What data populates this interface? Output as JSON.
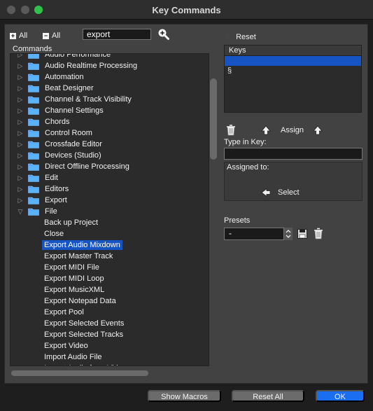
{
  "window": {
    "title": "Key Commands"
  },
  "toolbar": {
    "expand_all_label": "All",
    "collapse_all_label": "All",
    "search_value": "export",
    "commands_label": "Commands"
  },
  "tree": {
    "folders": [
      "Audio Performance",
      "Audio Realtime Processing",
      "Automation",
      "Beat Designer",
      "Channel & Track Visibility",
      "Channel Settings",
      "Chords",
      "Control Room",
      "Crossfade Editor",
      "Devices (Studio)",
      "Direct Offline Processing",
      "Edit",
      "Editors",
      "Export"
    ],
    "open_folder": "File",
    "file_items": [
      "Back up Project",
      "Close",
      "Export Audio Mixdown",
      "Export Master Track",
      "Export MIDI File",
      "Export MIDI Loop",
      "Export MusicXML",
      "Export Notepad Data",
      "Export Pool",
      "Export Selected Events",
      "Export Selected Tracks",
      "Export Video",
      "Import Audio File",
      "Import Audio from Video"
    ],
    "selected_index": 2
  },
  "right": {
    "reset_label": "Reset",
    "keys_header": "Keys",
    "keys": [
      "",
      "§"
    ],
    "assign_label": "Assign",
    "type_in_key_label": "Type in Key:",
    "type_in_key_value": "",
    "assigned_to_label": "Assigned to:",
    "select_label": "Select",
    "presets_label": "Presets",
    "presets_value": "-"
  },
  "buttons": {
    "show_macros": "Show Macros",
    "reset_all": "Reset All",
    "ok": "OK"
  },
  "colors": {
    "accent": "#1754c3",
    "ok_button": "#1b6ef0",
    "folder": "#4da3f0"
  },
  "icons": {
    "tree_folder": "folder-icon",
    "search": "search-magnifier-icon",
    "delete": "trash-icon",
    "up": "up-arrow-icon",
    "left": "left-arrow-icon",
    "save": "floppy-disk-icon"
  }
}
